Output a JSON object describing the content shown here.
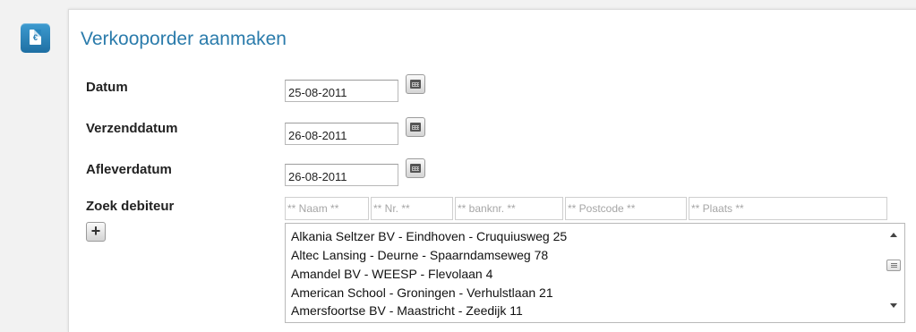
{
  "page": {
    "title": "Verkooporder aanmaken",
    "icon": "euro-document-icon"
  },
  "form": {
    "datum": {
      "label": "Datum",
      "value": "25-08-2011"
    },
    "verzenddatum": {
      "label": "Verzenddatum",
      "value": "26-08-2011"
    },
    "afleverdatum": {
      "label": "Afleverdatum",
      "value": "26-08-2011"
    },
    "calendar_icon": "calendar-icon"
  },
  "debtor_search": {
    "label": "Zoek debiteur",
    "add_icon": "plus-icon",
    "filters": {
      "naam": "** Naam **",
      "nr": "** Nr. **",
      "banknr": "** banknr. **",
      "postcode": "** Postcode **",
      "plaats": "** Plaats **"
    },
    "results": [
      "Alkania Seltzer BV - Eindhoven - Cruquiusweg 25",
      "Altec Lansing - Deurne - Spaarndamseweg 78",
      "Amandel BV - WEESP - Flevolaan 4",
      "American School - Groningen - Verhulstlaan 21",
      "Amersfoortse BV - Maastricht - Zeedijk 11"
    ]
  },
  "colors": {
    "accent": "#2a7bab",
    "icon_bg": "#2a86bd",
    "panel_bg": "#ffffff",
    "page_bg": "#f2f2f2"
  }
}
